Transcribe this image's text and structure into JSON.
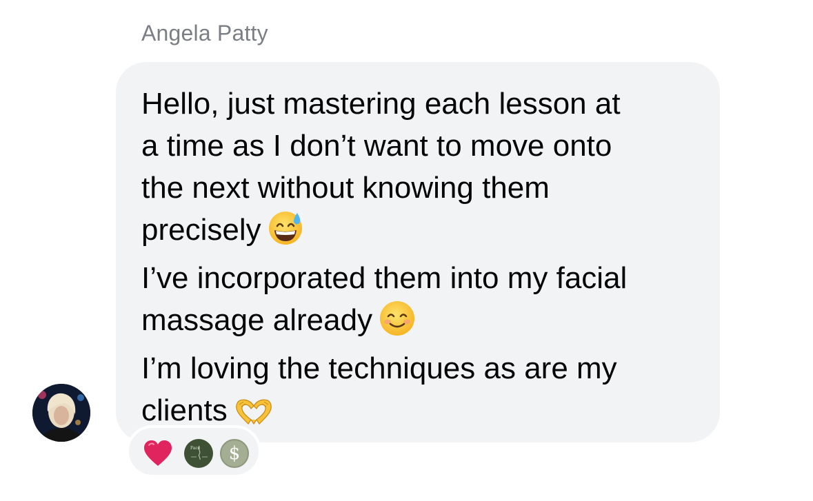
{
  "message": {
    "sender_name": "Angela Patty",
    "lines": [
      "Hello, just mastering each lesson at",
      "a time as I don’t want to move onto",
      "the next without knowing them",
      "precisely",
      "I’ve incorporated them into my facial",
      "massage already",
      "I’m loving the techniques as are my",
      "clients"
    ],
    "emojis": {
      "precisely": "grinning-face-with-sweat-icon",
      "already": "smiling-face-with-smiling-eyes-icon",
      "clients": "heart-hands-icon"
    }
  },
  "reactions": [
    {
      "type": "heart",
      "icon": "red-heart-icon"
    },
    {
      "type": "page-avatar",
      "icon": "face-logo-icon",
      "text": "Face"
    },
    {
      "type": "page-avatar",
      "icon": "dollar-logo-icon",
      "text": "$"
    }
  ],
  "colors": {
    "bubble_background": "#f2f3f5",
    "sender_name": "#7b7e84",
    "message_text": "#050505",
    "heart": "#e0245e"
  }
}
